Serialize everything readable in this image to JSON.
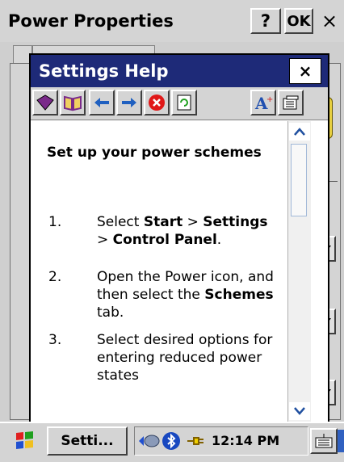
{
  "power_window": {
    "title": "Power Properties",
    "help_button": "?",
    "ok_button": "OK",
    "close_button": "×"
  },
  "help_window": {
    "title": "Settings Help",
    "close_button": "×",
    "heading": "Set up your power schemes",
    "steps": [
      {
        "num": "1.",
        "parts": [
          "Select ",
          "Start",
          " > ",
          "Settings",
          " > ",
          "Control Panel",
          "."
        ]
      },
      {
        "num": "2.",
        "parts": [
          "Open the Power icon, and then select the ",
          "Schemes",
          " tab."
        ]
      },
      {
        "num": "3.",
        "parts": [
          "Select desired options for entering reduced power states"
        ]
      }
    ],
    "toolbar_icons": [
      "book-icon",
      "open-book-icon",
      "back-arrow-icon",
      "forward-arrow-icon",
      "stop-icon",
      "refresh-icon",
      "font-size-icon",
      "options-icon"
    ]
  },
  "taskbar": {
    "task_label": "Setti...",
    "clock": "12:14 PM"
  },
  "colors": {
    "help_title_bg": "#1e2a78",
    "taskbar_bg": "#d4d4d4"
  }
}
